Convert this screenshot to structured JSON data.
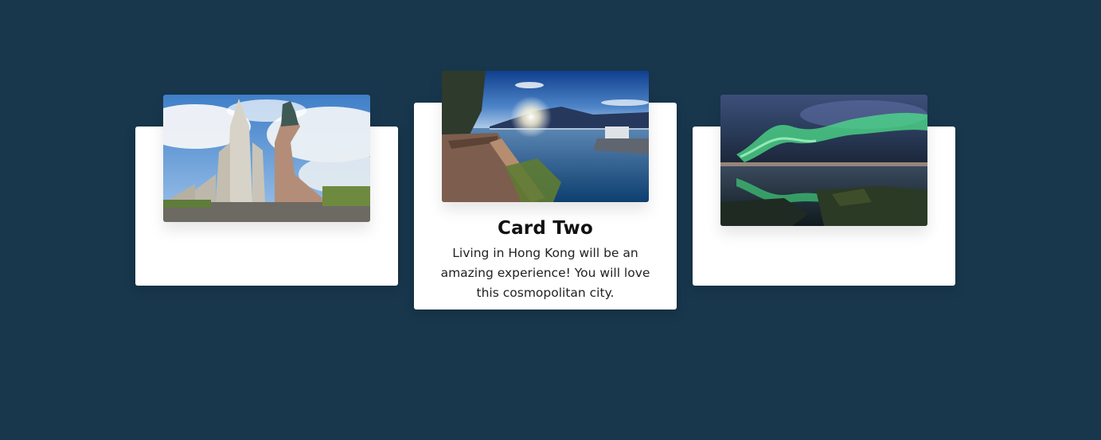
{
  "cards": [
    {
      "title": "",
      "text": ""
    },
    {
      "title": "Card Two",
      "text": "Living in Hong Kong will be an amazing experience! You will love this cosmopolitan city."
    },
    {
      "title": "",
      "text": ""
    }
  ],
  "colors": {
    "background": "#18374d",
    "card": "#ffffff",
    "title": "#111111"
  }
}
